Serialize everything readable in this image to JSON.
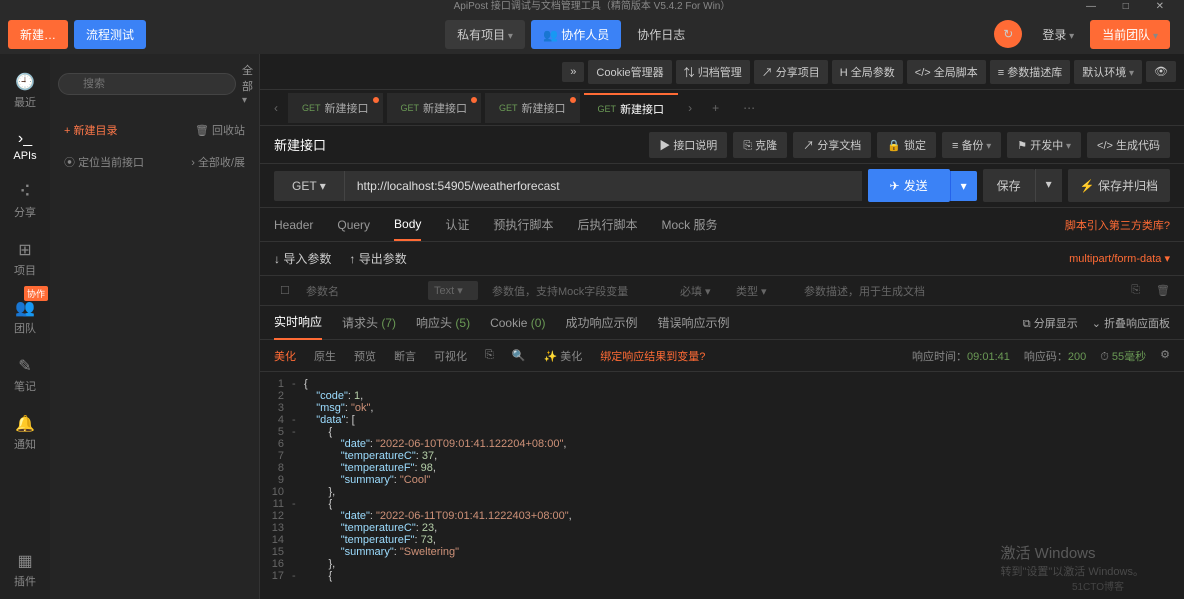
{
  "title": "ApiPost 接口调试与文档管理工具（精简版本 V5.4.2 For Win）",
  "topbar": {
    "new": "新建…",
    "flowtest": "流程测试",
    "private_proj": "私有项目",
    "collab": "协作人员",
    "collab_log": "协作日志",
    "login": "登录",
    "team": "当前团队"
  },
  "leftnav": {
    "recent": "最近",
    "apis": "APIs",
    "share": "分享",
    "project": "项目",
    "team": "团队",
    "team_badge": "协作",
    "notes": "笔记",
    "notify": "通知",
    "plugins": "插件"
  },
  "side": {
    "search_ph": "搜索",
    "all": "全部",
    "new_dir": "+  新建目录",
    "recycle": "回收站",
    "locate": "定位当前接口",
    "expand": "全部收/展"
  },
  "toolbar2": {
    "more": "»",
    "cookie": "Cookie管理器",
    "archive": "归档管理",
    "share_proj": "分享项目",
    "global_param": "全局参数",
    "global_script": "全局脚本",
    "param_lib": "参数描述库",
    "default_env": "默认环境"
  },
  "tabs": [
    {
      "method": "GET",
      "label": "新建接口",
      "dot": true
    },
    {
      "method": "GET",
      "label": "新建接口",
      "dot": true
    },
    {
      "method": "GET",
      "label": "新建接口",
      "dot": true
    },
    {
      "method": "GET",
      "label": "新建接口",
      "dot": false,
      "active": true
    }
  ],
  "req": {
    "name": "新建接口",
    "actions": {
      "desc": "接口说明",
      "clone": "克隆",
      "share_doc": "分享文档",
      "lock": "锁定",
      "backup": "备份",
      "dev": "开发中",
      "gen_code": "生成代码"
    },
    "method": "GET",
    "url": "http://localhost:54905/weatherforecast",
    "send": "发送",
    "save": "保存",
    "save_archive": "保存并归档"
  },
  "reqtabs": {
    "header": "Header",
    "query": "Query",
    "body": "Body",
    "auth": "认证",
    "prescript": "预执行脚本",
    "postscript": "后执行脚本",
    "mock": "Mock 服务",
    "thirdparty": "脚本引入第三方类库?"
  },
  "params": {
    "import": "导入参数",
    "export": "导出参数",
    "format": "multipart/form-data",
    "name_ph": "参数名",
    "type": "Text",
    "value_ph": "参数值，支持Mock字段变量",
    "required": "必填",
    "dtype": "类型",
    "desc_ph": "参数描述，用于生成文档"
  },
  "resptabs": {
    "realtime": "实时响应",
    "reqhead": "请求头",
    "reqhead_n": "(7)",
    "resphead": "响应头",
    "resphead_n": "(5)",
    "cookie": "Cookie",
    "cookie_n": "(0)",
    "success": "成功响应示例",
    "error": "错误响应示例",
    "split": "分屏显示",
    "collapse": "折叠响应面板"
  },
  "viewbar": {
    "pretty": "美化",
    "raw": "原生",
    "preview": "预览",
    "assert": "断言",
    "visual": "可视化",
    "beautify": "美化",
    "bindvar": "绑定响应结果到变量?",
    "resp_time_lbl": "响应时间：",
    "resp_time": "09:01:41",
    "resp_code_lbl": "响应码：",
    "resp_code": "200",
    "duration": "55毫秒"
  },
  "code_lines": [
    {
      "n": 1,
      "fold": "-",
      "html": "<span class='punc'>{</span>"
    },
    {
      "n": 2,
      "fold": "",
      "html": "    <span class='key'>\"code\"</span><span class='punc'>: </span><span class='num'>1</span><span class='punc'>,</span>"
    },
    {
      "n": 3,
      "fold": "",
      "html": "    <span class='key'>\"msg\"</span><span class='punc'>: </span><span class='str'>\"ok\"</span><span class='punc'>,</span>"
    },
    {
      "n": 4,
      "fold": "-",
      "html": "    <span class='key'>\"data\"</span><span class='punc'>: [</span>"
    },
    {
      "n": 5,
      "fold": "-",
      "html": "        <span class='punc'>{</span>"
    },
    {
      "n": 6,
      "fold": "",
      "html": "            <span class='key'>\"date\"</span><span class='punc'>: </span><span class='str'>\"2022-06-10T09:01:41.122204+08:00\"</span><span class='punc'>,</span>"
    },
    {
      "n": 7,
      "fold": "",
      "html": "            <span class='key'>\"temperatureC\"</span><span class='punc'>: </span><span class='num'>37</span><span class='punc'>,</span>"
    },
    {
      "n": 8,
      "fold": "",
      "html": "            <span class='key'>\"temperatureF\"</span><span class='punc'>: </span><span class='num'>98</span><span class='punc'>,</span>"
    },
    {
      "n": 9,
      "fold": "",
      "html": "            <span class='key'>\"summary\"</span><span class='punc'>: </span><span class='str'>\"Cool\"</span>"
    },
    {
      "n": 10,
      "fold": "",
      "html": "        <span class='punc'>},</span>"
    },
    {
      "n": 11,
      "fold": "-",
      "html": "        <span class='punc'>{</span>"
    },
    {
      "n": 12,
      "fold": "",
      "html": "            <span class='key'>\"date\"</span><span class='punc'>: </span><span class='str'>\"2022-06-11T09:01:41.1222403+08:00\"</span><span class='punc'>,</span>"
    },
    {
      "n": 13,
      "fold": "",
      "html": "            <span class='key'>\"temperatureC\"</span><span class='punc'>: </span><span class='num'>23</span><span class='punc'>,</span>"
    },
    {
      "n": 14,
      "fold": "",
      "html": "            <span class='key'>\"temperatureF\"</span><span class='punc'>: </span><span class='num'>73</span><span class='punc'>,</span>"
    },
    {
      "n": 15,
      "fold": "",
      "html": "            <span class='key'>\"summary\"</span><span class='punc'>: </span><span class='str'>\"Sweltering\"</span>"
    },
    {
      "n": 16,
      "fold": "",
      "html": "        <span class='punc'>},</span>"
    },
    {
      "n": 17,
      "fold": "-",
      "html": "        <span class='punc'>{</span>"
    }
  ],
  "watermark": {
    "main": "激活 Windows",
    "sub": "转到\"设置\"以激活 Windows。",
    "blog": "51CTO博客"
  }
}
